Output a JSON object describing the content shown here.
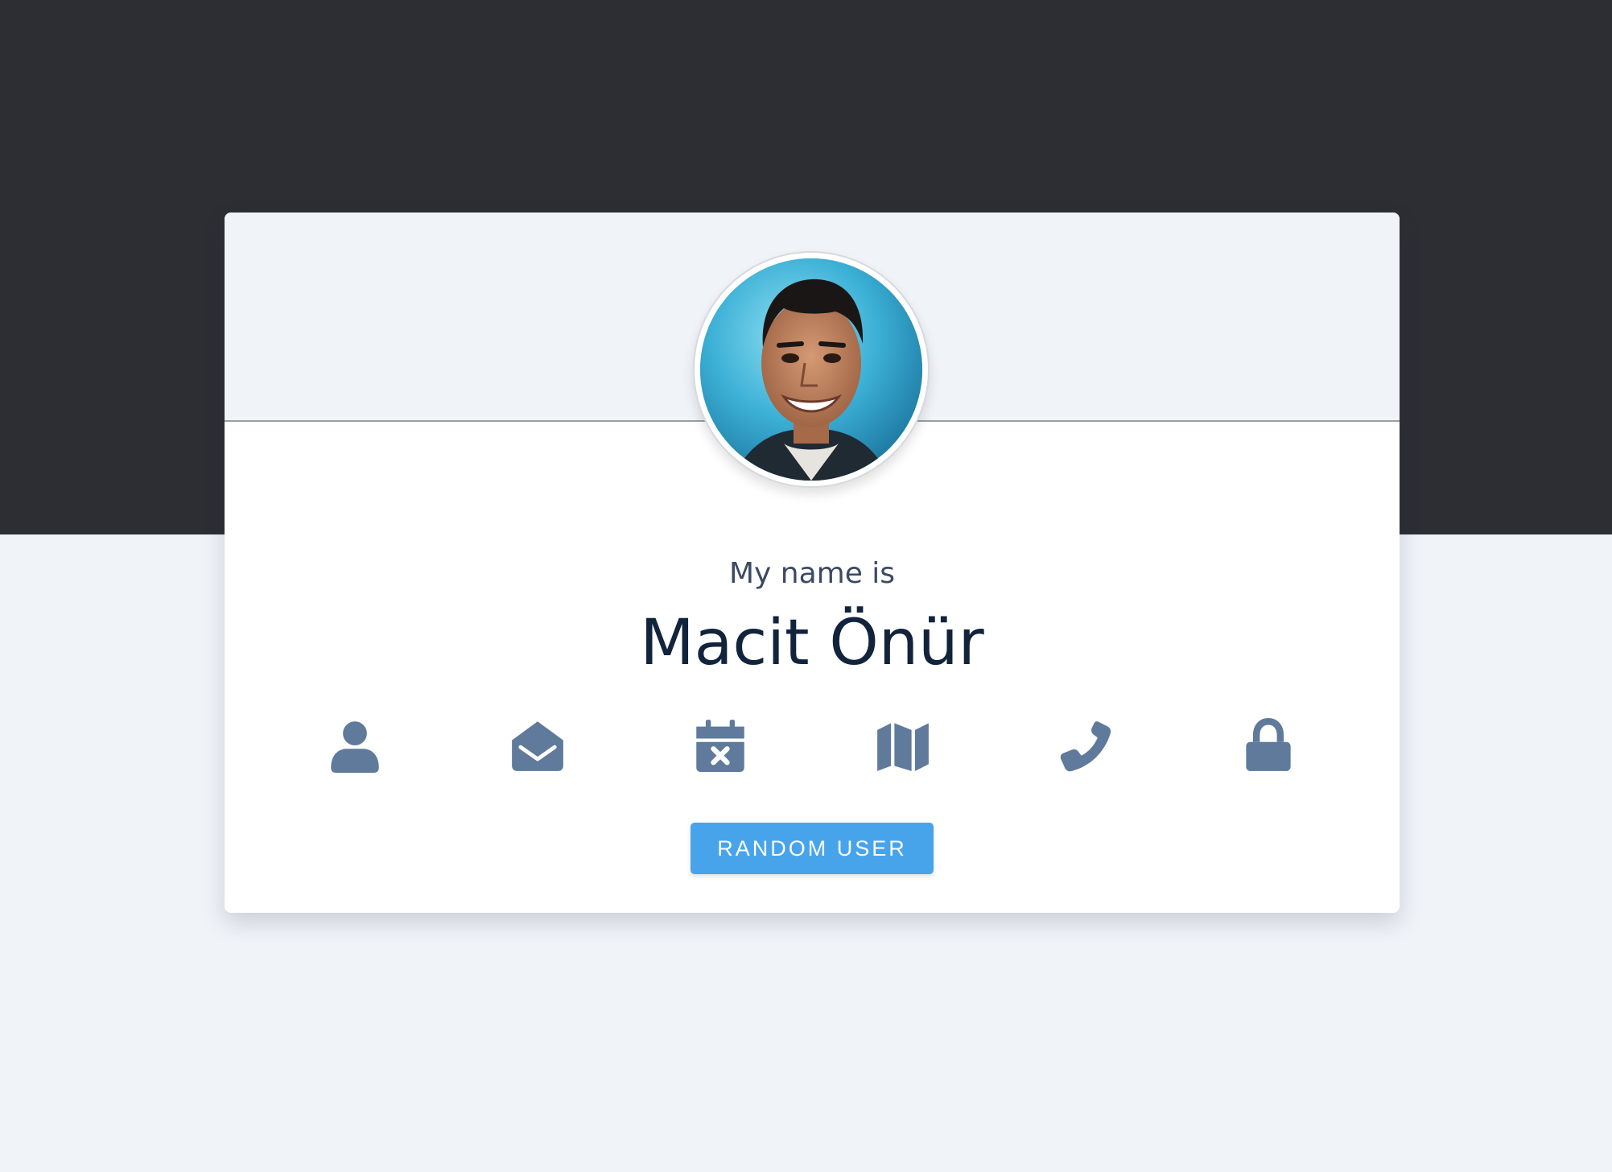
{
  "profile": {
    "label": "My name is",
    "name": "Macit Önür"
  },
  "icons": [
    {
      "name": "user-icon"
    },
    {
      "name": "envelope-open-icon"
    },
    {
      "name": "calendar-icon"
    },
    {
      "name": "map-icon"
    },
    {
      "name": "phone-icon"
    },
    {
      "name": "lock-icon"
    }
  ],
  "button": {
    "label": "RANDOM USER"
  },
  "colors": {
    "top_band": "#2d2e34",
    "background": "#f0f3f8",
    "icon": "#5f7a9b",
    "button": "#48a4ea",
    "name_text": "#12233c"
  }
}
